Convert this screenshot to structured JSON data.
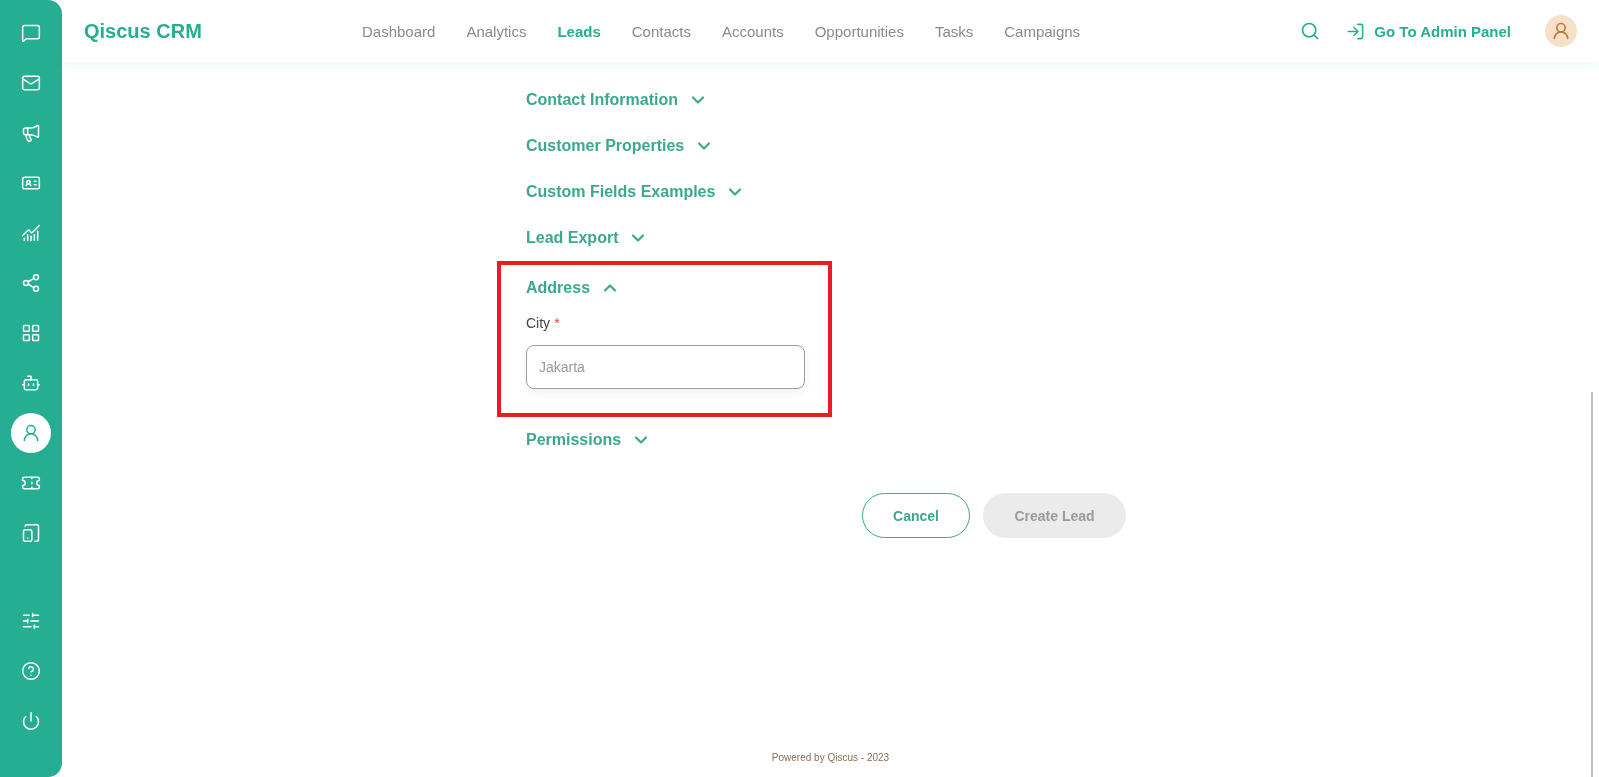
{
  "sidebar": {
    "items": [
      {
        "selected": false
      },
      {
        "selected": false
      },
      {
        "selected": false
      },
      {
        "selected": false
      },
      {
        "selected": false
      },
      {
        "selected": false
      },
      {
        "selected": false
      },
      {
        "selected": false
      },
      {
        "selected": true
      },
      {
        "selected": false
      },
      {
        "selected": false
      }
    ]
  },
  "header": {
    "logo": "Qiscus CRM",
    "nav": [
      {
        "label": "Dashboard",
        "selected": false
      },
      {
        "label": "Analytics",
        "selected": false
      },
      {
        "label": "Leads",
        "selected": true
      },
      {
        "label": "Contacts",
        "selected": false
      },
      {
        "label": "Accounts",
        "selected": false
      },
      {
        "label": "Opportunities",
        "selected": false
      },
      {
        "label": "Tasks",
        "selected": false
      },
      {
        "label": "Campaigns",
        "selected": false
      }
    ],
    "admin_link": "Go To Admin Panel"
  },
  "sections": [
    {
      "title": "Contact Information",
      "expanded": false,
      "highlighted": false
    },
    {
      "title": "Customer Properties",
      "expanded": false,
      "highlighted": false
    },
    {
      "title": "Custom Fields Examples",
      "expanded": false,
      "highlighted": false
    },
    {
      "title": "Lead Export",
      "expanded": false,
      "highlighted": false
    },
    {
      "title": "Address",
      "expanded": true,
      "highlighted": true,
      "fields": [
        {
          "label": "City",
          "required_mark": "*",
          "placeholder": "Jakarta"
        }
      ]
    },
    {
      "title": "Permissions",
      "expanded": false,
      "highlighted": false
    }
  ],
  "buttons": {
    "cancel": "Cancel",
    "create": {
      "label": "Create Lead",
      "disabled": true
    }
  },
  "footer": "Powered by Qiscus - 2023"
}
